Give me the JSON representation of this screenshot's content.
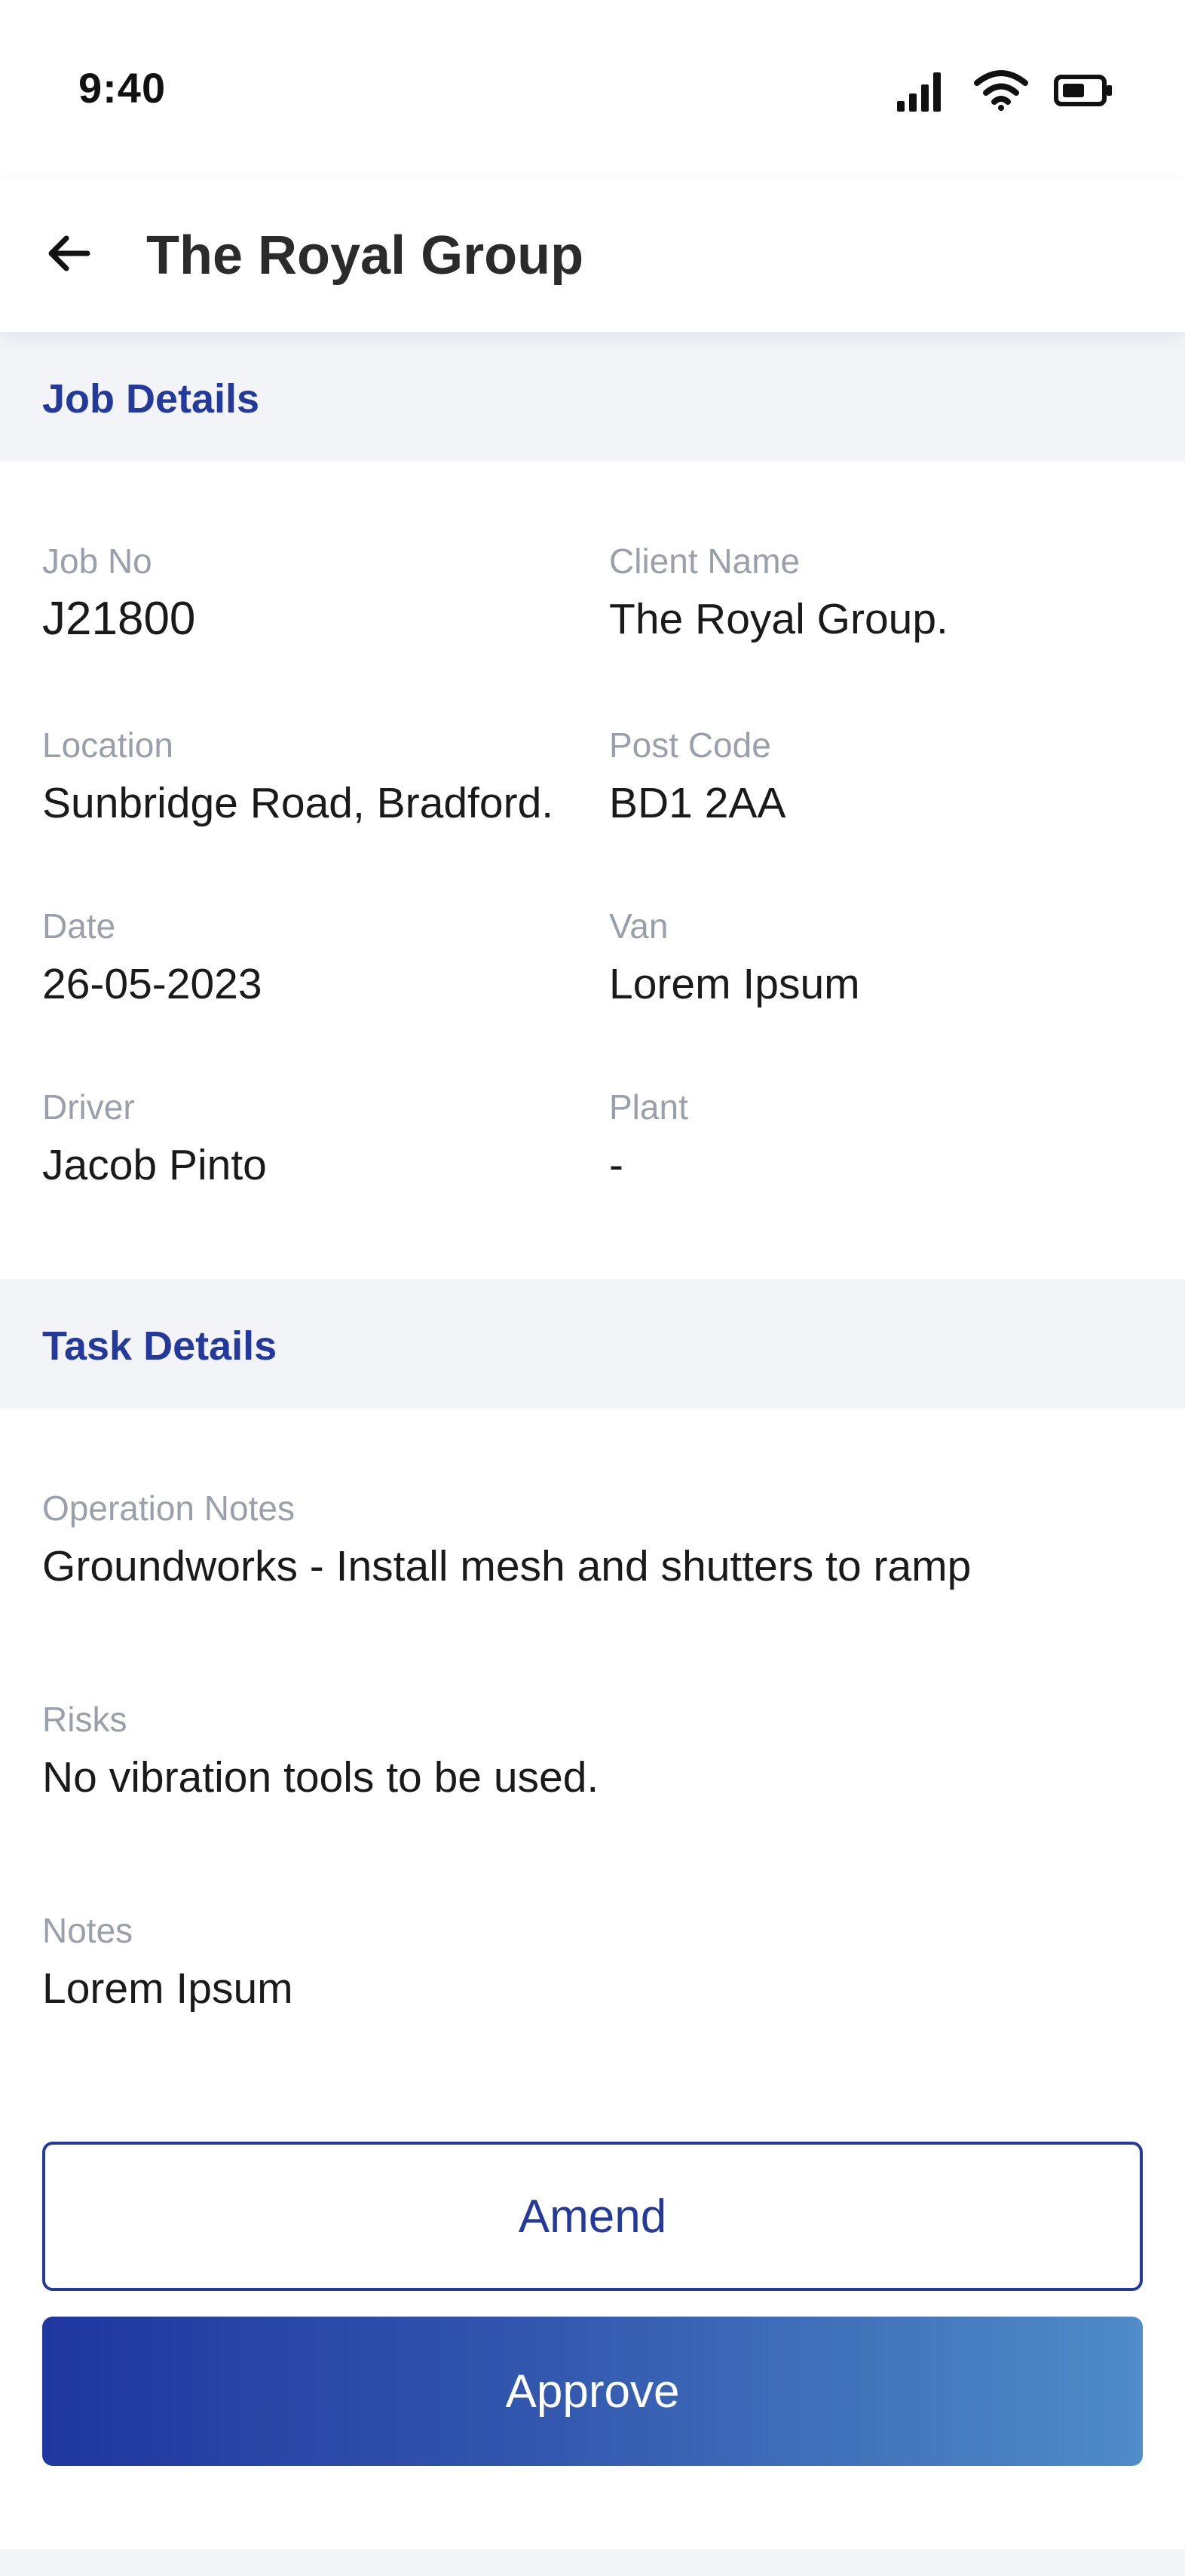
{
  "status_bar": {
    "time": "9:40"
  },
  "header": {
    "title": "The Royal Group"
  },
  "job_details": {
    "heading": "Job Details",
    "fields": [
      {
        "label": "Job No",
        "value": "J21800"
      },
      {
        "label": "Client Name",
        "value": "The Royal Group."
      },
      {
        "label": "Location",
        "value": "Sunbridge Road, Bradford."
      },
      {
        "label": "Post Code",
        "value": "BD1 2AA"
      },
      {
        "label": "Date",
        "value": "26-05-2023"
      },
      {
        "label": "Van",
        "value": "Lorem Ipsum"
      },
      {
        "label": "Driver",
        "value": "Jacob Pinto"
      },
      {
        "label": "Plant",
        "value": "-"
      }
    ]
  },
  "task_details": {
    "heading": "Task Details",
    "fields": [
      {
        "label": "Operation Notes",
        "value": "Groundworks - Install mesh and shutters to ramp"
      },
      {
        "label": "Risks",
        "value": "No vibration tools to be used."
      },
      {
        "label": "Notes",
        "value": "Lorem Ipsum"
      }
    ]
  },
  "actions": {
    "amend_label": "Amend",
    "approve_label": "Approve"
  },
  "colors": {
    "accent": "#23399b",
    "gradient_start": "#1f37a0",
    "gradient_end": "#4f8cc8",
    "section_bg": "#f3f4f8",
    "label": "#9aa0aa"
  },
  "icons": {
    "back": "arrow-left-icon",
    "signal": "cellular-signal-icon",
    "wifi": "wifi-icon",
    "battery": "battery-icon"
  }
}
